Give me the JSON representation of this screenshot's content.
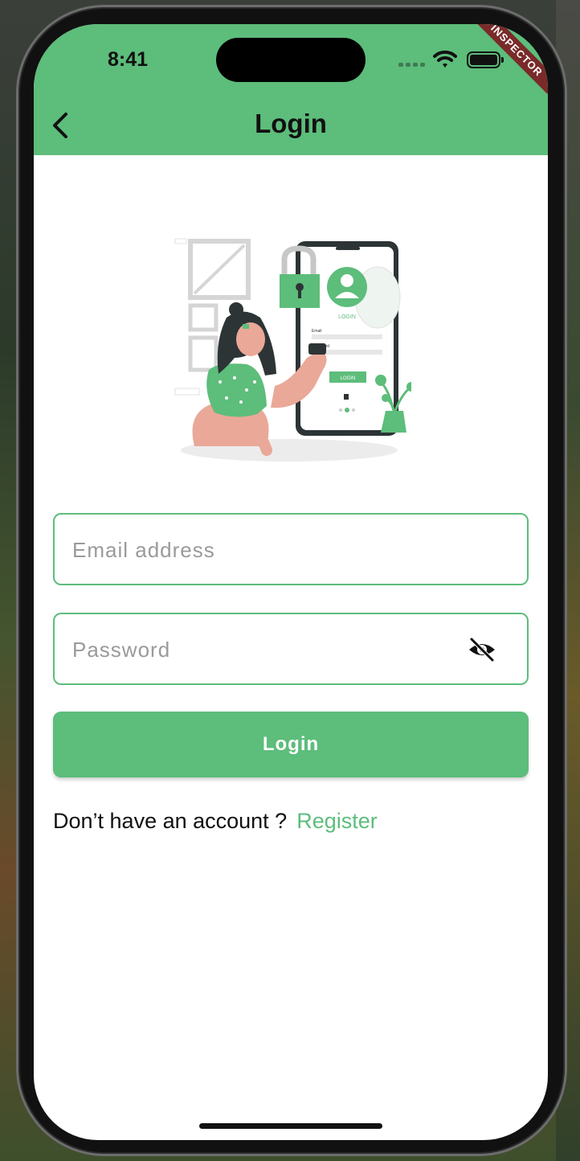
{
  "status_bar": {
    "time": "8:41"
  },
  "debug_ribbon": "INSPECTOR",
  "app_bar": {
    "title": "Login",
    "back_icon": "chevron-left-icon"
  },
  "illustration": {
    "name": "person-phone-login-illustration",
    "phone_texts": {
      "heading": "LOGIN",
      "email": "Email",
      "password": "Password",
      "button": "LOGIN"
    }
  },
  "form": {
    "email_placeholder": "Email address",
    "password_placeholder": "Password",
    "password_toggle_icon": "eye-slash-icon",
    "login_label": "Login"
  },
  "footer": {
    "prompt": "Don’t have an account ?",
    "register_label": "Register"
  },
  "colors": {
    "accent": "#5dbd7b",
    "text": "#111111",
    "placeholder": "#9a9a9a",
    "ribbon": "#7a2a2a"
  }
}
